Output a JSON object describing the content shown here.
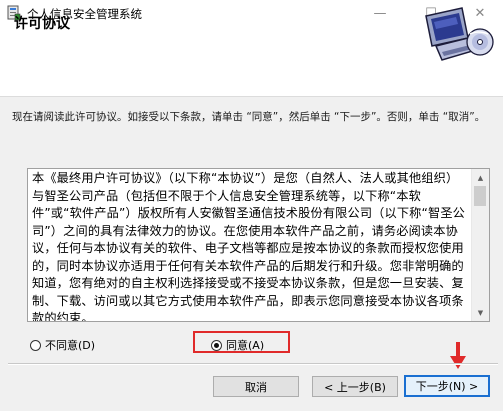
{
  "window": {
    "title": "个人信息安全管理系统",
    "minimize_glyph": "—",
    "maximize_glyph": "☐",
    "close_glyph": "✕"
  },
  "header": {
    "title": "许可协议"
  },
  "instructions": "现在请阅读此许可协议。如接受以下条款，请单击 “同意”，然后单击 “下一步”。否则，单击 “取消”。",
  "license": {
    "text": "本《最终用户许可协议》（以下称“本协议”）是您（自然人、法人或其他组织）与智圣公司产品（包括但不限于个人信息安全管理系统等，以下称“本软件”或“软件产品”）版权所有人安徽智圣通信技术股份有限公司（以下称“智圣公司”）之间的具有法律效力的协议。在您使用本软件产品之前，请务必阅读本协议，任何与本协议有关的软件、电子文档等都应是按本协议的条款而授权您使用的，同时本协议亦适用于任何有关本软件产品的后期发行和升级。您非常明确的知道，您有绝对的自主权利选择接受或不接受本协议条款，但是您一旦安装、复制、下载、访问或以其它方式使用本软件产品，即表示您同意接受本协议各项条款的约束。"
  },
  "options": {
    "disagree": "不同意(D)",
    "agree": "同意(A)",
    "selected": "agree"
  },
  "buttons": {
    "cancel": "取消",
    "back": "< 上一步(B)",
    "next": "下一步(N) >"
  },
  "colors": {
    "highlight": "#e02a2a",
    "focus": "#1a6fd1"
  }
}
